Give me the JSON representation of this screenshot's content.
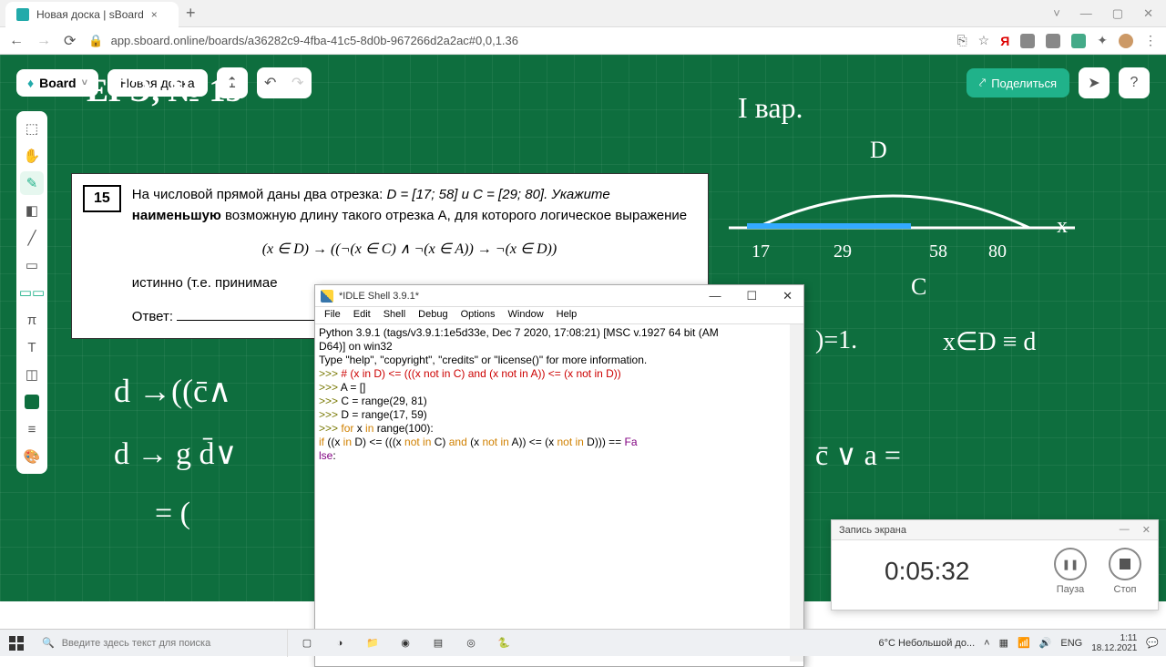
{
  "browser": {
    "tab_title": "Новая доска | sBoard",
    "url": "app.sboard.online/boards/a36282c9-4fba-41c5-8d0b-967266d2a2ac#0,0,1.36"
  },
  "sboard": {
    "logo": "Board",
    "board_name": "Новая доска",
    "share": "Поделиться"
  },
  "problem": {
    "num": "15",
    "p1_a": "На числовой прямой даны два отрезка: ",
    "p1_b": "D = [17; 58] и C = [29; 80]. Укажите ",
    "p2_a": "наименьшую",
    "p2_b": " возможную длину такого отрезка A, для которого логическое выражение",
    "formula": "(x ∈ D) → ((¬(x ∈ C) ∧ ¬(x ∈ A)) → ¬(x ∈ D))",
    "p3": "истинно (т.е. принимае",
    "answer_label": "Ответ: "
  },
  "handwriting": {
    "title": "ЕГЭ, № 15",
    "var1": "I вар.",
    "d": "D",
    "c": "C",
    "x": "x",
    "n17": "17",
    "n29": "29",
    "n58": "58",
    "n80": "80",
    "eq1": ")=1.",
    "eq2": "x∈D ≡ d",
    "eq3": "d →((c̄∧",
    "eq4": "d → g    d̄∨",
    "eq5": "= (",
    "eq6": "c̄ ∨ a ="
  },
  "idle": {
    "title": "*IDLE Shell 3.9.1*",
    "menu": [
      "File",
      "Edit",
      "Shell",
      "Debug",
      "Options",
      "Window",
      "Help"
    ],
    "l1": "Python 3.9.1 (tags/v3.9.1:1e5d33e, Dec  7 2020, 17:08:21) [MSC v.1927 64 bit (AM",
    "l2": "D64)] on win32",
    "l3": "Type \"help\", \"copyright\", \"credits\" or \"license()\" for more information.",
    "c1": "# (x in D) <= (((x not in C) and (x not in A)) <= (x not in D))",
    "s1": "A = []",
    "s2": "C = range(29, 81)",
    "s3": "D = range(17, 59)",
    "s4a": "for",
    "s4b": " x ",
    "s4c": "in",
    "s4d": " range(100):",
    "s5a": "        if",
    "s5b": " ((x ",
    "s5c": "in",
    "s5d": " D) <= (((x ",
    "s5e": "not in",
    "s5f": " C) ",
    "s5g": "and",
    "s5h": " (x ",
    "s5i": "not in",
    "s5j": " A)) <= (x ",
    "s5k": "not in",
    "s5l": " D))) == ",
    "s5m": "Fa",
    "s6": "lse",
    "s6b": ":"
  },
  "rec": {
    "title": "Запись экрана",
    "time": "0:05:32",
    "pause": "Пауза",
    "stop": "Стоп"
  },
  "taskbar": {
    "search_ph": "Введите здесь текст для поиска",
    "weather": "6°C  Небольшой до...",
    "lang": "ENG",
    "time": "1:11",
    "date": "18.12.2021"
  }
}
